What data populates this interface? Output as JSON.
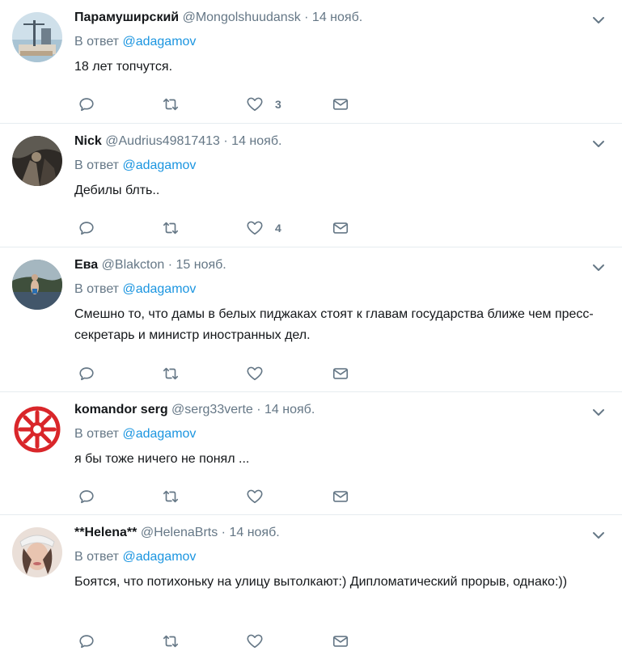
{
  "tweets": [
    {
      "name": "Парамуширский",
      "handle": "@Mongolshuudansk",
      "dot": "·",
      "time": "14 нояб.",
      "reply_prefix": "В ответ",
      "reply_to": "@adagamov",
      "text": "18 лет топчутся.",
      "likes": "3"
    },
    {
      "name": "Nick",
      "handle": "@Audrius49817413",
      "dot": "·",
      "time": "14 нояб.",
      "reply_prefix": "В ответ",
      "reply_to": "@adagamov",
      "text": "Дебилы блть..",
      "likes": "4"
    },
    {
      "name": "Ева",
      "handle": "@Blakcton",
      "dot": "·",
      "time": "15 нояб.",
      "reply_prefix": "В ответ",
      "reply_to": "@adagamov",
      "text": "Смешно то, что дамы в белых пиджаках стоят к главам государства ближе чем пресс-секретарь и министр иностранных дел.",
      "likes": ""
    },
    {
      "name": "komandor serg",
      "handle": "@serg33verte",
      "dot": "·",
      "time": "14 нояб.",
      "reply_prefix": "В ответ",
      "reply_to": "@adagamov",
      "text": "я бы тоже ничего не понял ...",
      "likes": ""
    },
    {
      "name": "**Helena**",
      "handle": "@HelenaBrts",
      "dot": "·",
      "time": "14 нояб.",
      "reply_prefix": "В ответ",
      "reply_to": "@adagamov",
      "text": "Боятся, что потихоньку на улицу вытолкают:) Дипломатический прорыв, однако:))",
      "likes": ""
    }
  ],
  "colors": {
    "link": "#1b95e0",
    "muted": "#657786",
    "text": "#14171a",
    "divider": "#e6ecf0"
  },
  "icons": [
    "chevron-down-icon",
    "reply-icon",
    "retweet-icon",
    "like-icon",
    "message-icon"
  ]
}
